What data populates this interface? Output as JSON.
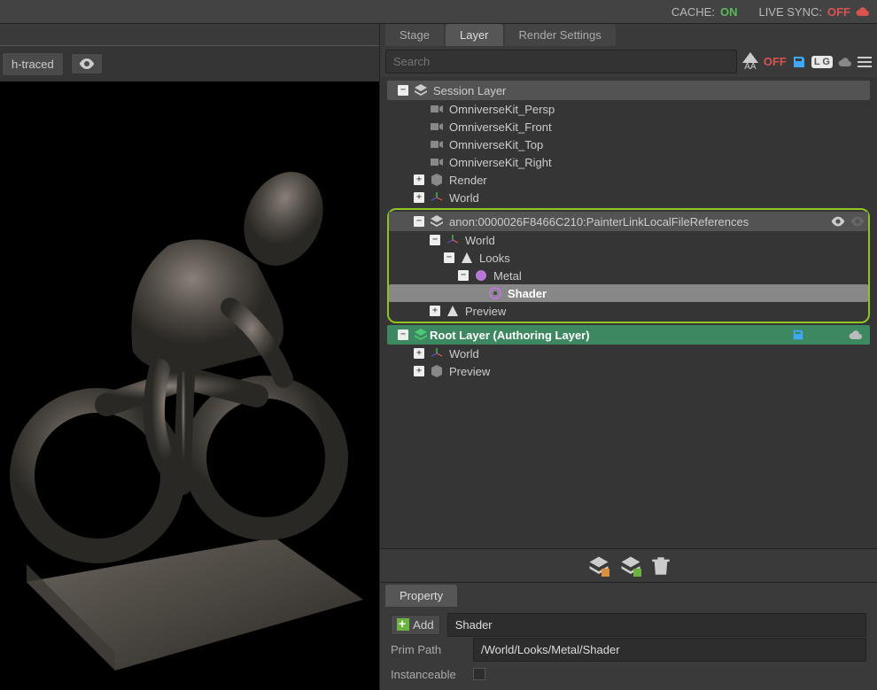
{
  "topbar": {
    "cache_label": "CACHE:",
    "cache_status": "ON",
    "livesync_label": "LIVE SYNC:",
    "livesync_status": "OFF"
  },
  "viewport": {
    "render_mode": "h-traced"
  },
  "tabs": {
    "stage": "Stage",
    "layer": "Layer",
    "render_settings": "Render Settings"
  },
  "search": {
    "placeholder": "Search",
    "aa_label": "AA",
    "off": "OFF",
    "lg": "L G"
  },
  "tree": {
    "session_layer": "Session Layer",
    "persp": "OmniverseKit_Persp",
    "front": "OmniverseKit_Front",
    "top": "OmniverseKit_Top",
    "right": "OmniverseKit_Right",
    "render": "Render",
    "world": "World",
    "anon_layer": "anon:0000026F8466C210:PainterLinkLocalFileReferences",
    "looks": "Looks",
    "metal": "Metal",
    "shader": "Shader",
    "preview": "Preview",
    "root_layer": "Root Layer (Authoring Layer)"
  },
  "property": {
    "tab": "Property",
    "add": "Add",
    "name_value": "Shader",
    "prim_path_label": "Prim Path",
    "prim_path_value": "/World/Looks/Metal/Shader",
    "instanceable_label": "Instanceable"
  }
}
